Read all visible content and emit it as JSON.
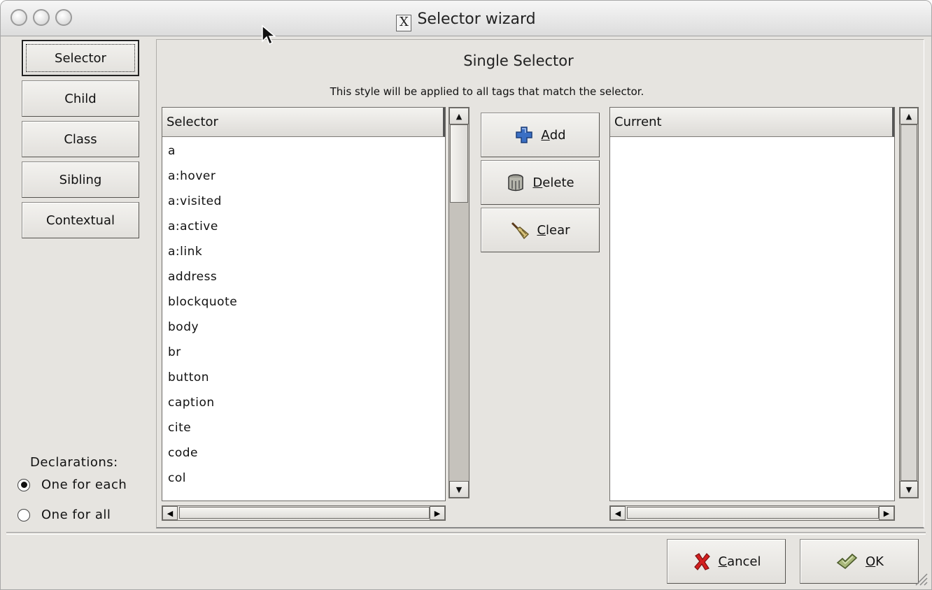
{
  "window": {
    "title": "Selector wizard",
    "title_icon": "x11-icon"
  },
  "tabs": [
    {
      "label": "Selector",
      "active": true
    },
    {
      "label": "Child",
      "active": false
    },
    {
      "label": "Class",
      "active": false
    },
    {
      "label": "Sibling",
      "active": false
    },
    {
      "label": "Contextual",
      "active": false
    }
  ],
  "main": {
    "heading": "Single Selector",
    "description": "This style will be applied to all tags that match the selector.",
    "selector_list": {
      "header": "Selector",
      "items": [
        "a",
        "a:hover",
        "a:visited",
        "a:active",
        "a:link",
        "address",
        "blockquote",
        "body",
        "br",
        "button",
        "caption",
        "cite",
        "code",
        "col"
      ]
    },
    "current_list": {
      "header": "Current",
      "items": []
    },
    "actions": {
      "add": {
        "label": "Add",
        "mnemonic": "A",
        "rest": "dd",
        "icon": "plus-icon"
      },
      "delete": {
        "label": "Delete",
        "mnemonic": "D",
        "rest": "elete",
        "icon": "trash-can-icon"
      },
      "clear": {
        "label": "Clear",
        "mnemonic": "C",
        "rest": "lear",
        "icon": "broom-icon"
      }
    }
  },
  "declarations": {
    "label": "Declarations:",
    "options": [
      {
        "label": "One for each",
        "selected": true
      },
      {
        "label": "One for all",
        "selected": false
      }
    ]
  },
  "footer": {
    "cancel": {
      "label": "Cancel",
      "mnemonic": "C",
      "rest": "ancel",
      "icon": "red-x-icon"
    },
    "ok": {
      "label": "OK",
      "mnemonic": "O",
      "rest": "K",
      "icon": "checkmark-icon"
    }
  },
  "colors": {
    "window_bg": "#e6e4e0",
    "list_bg": "#ffffff",
    "scroll_trough": "#c5c2bc",
    "add_icon": "#3a6fc4",
    "cancel_icon": "#d42020",
    "ok_icon": "#6f8a3a"
  }
}
